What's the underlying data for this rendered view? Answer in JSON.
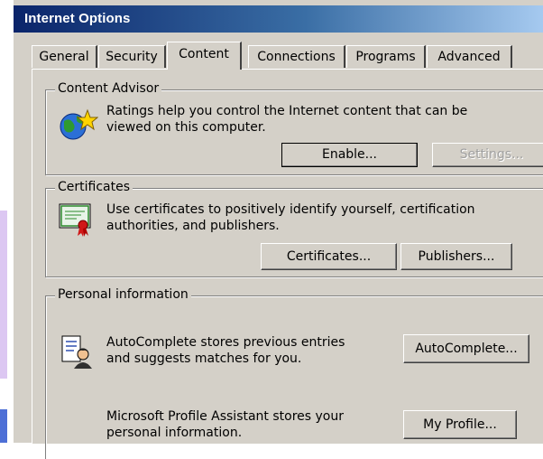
{
  "window": {
    "title": "Internet Options"
  },
  "tabs": [
    {
      "label": "General"
    },
    {
      "label": "Security"
    },
    {
      "label": "Content"
    },
    {
      "label": "Connections"
    },
    {
      "label": "Programs"
    },
    {
      "label": "Advanced"
    }
  ],
  "active_tab": "Content",
  "content_advisor": {
    "legend": "Content Advisor",
    "line1": "Ratings help you control the Internet content that can be",
    "line2": "viewed on this computer.",
    "enable_label": "Enable...",
    "settings_label": "Settings..."
  },
  "certificates": {
    "legend": "Certificates",
    "line1": "Use certificates to positively identify yourself, certification",
    "line2": "authorities, and publishers.",
    "certificates_label": "Certificates...",
    "publishers_label": "Publishers..."
  },
  "personal_information": {
    "legend": "Personal information",
    "autocomplete_line1": "AutoComplete stores previous entries",
    "autocomplete_line2": "and suggests matches for you.",
    "autocomplete_label": "AutoComplete...",
    "profile_line1": "Microsoft Profile Assistant stores your",
    "profile_line2": "personal information.",
    "profile_label": "My Profile..."
  },
  "colors": {
    "titlebar_start": "#0a246a",
    "titlebar_end": "#a6caf0",
    "dialog_face": "#d4d0c8"
  }
}
